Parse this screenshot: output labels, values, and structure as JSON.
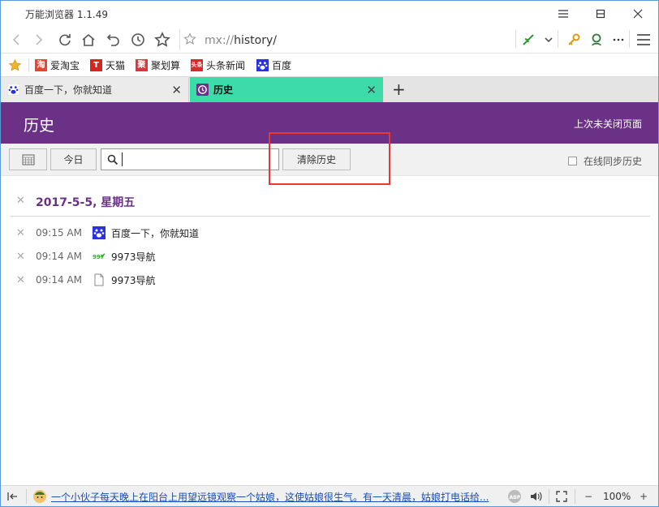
{
  "window": {
    "title": "万能浏览器 1.1.49"
  },
  "address": {
    "scheme": "mx://",
    "path": "history/"
  },
  "bookmarks": [
    {
      "label": "爱淘宝",
      "icon": "taobao-icon",
      "color": "#e8442e"
    },
    {
      "label": "天猫",
      "icon": "tmall-icon",
      "color": "#d7261f"
    },
    {
      "label": "聚划算",
      "icon": "juhuasuan-icon",
      "color": "#e0343b"
    },
    {
      "label": "头条新闻",
      "icon": "toutiao-icon",
      "color": "#d52b2b"
    },
    {
      "label": "百度",
      "icon": "baidu-icon",
      "color": "#2932e1"
    }
  ],
  "tabs": [
    {
      "label": "百度一下，你就知道",
      "active": false
    },
    {
      "label": "历史",
      "active": true
    }
  ],
  "page": {
    "title": "历史",
    "reopen_label": "上次未关闭页面",
    "accent": "#6b3187"
  },
  "toolbar": {
    "today_label": "今日",
    "search_value": "",
    "clear_label": "清除历史",
    "sync_label": "在线同步历史"
  },
  "history": {
    "date": "2017-5-5, 星期五",
    "entries": [
      {
        "time": "09:15 AM",
        "title": "百度一下，你就知道",
        "icon": "baidu-paw-icon"
      },
      {
        "time": "09:14 AM",
        "title": "9973导航",
        "icon": "nav9973-icon"
      },
      {
        "time": "09:14 AM",
        "title": "9973导航",
        "icon": "blank-page-icon"
      }
    ]
  },
  "status": {
    "news": "一个小伙子每天晚上在阳台上用望远镜观察一个姑娘，这使姑娘很生气。有一天清晨，姑娘打电话给...",
    "zoom": "100%"
  },
  "colors": {
    "tab_active": "#3ddbaa",
    "header": "#6b3187",
    "highlight_box": "#e53935"
  }
}
